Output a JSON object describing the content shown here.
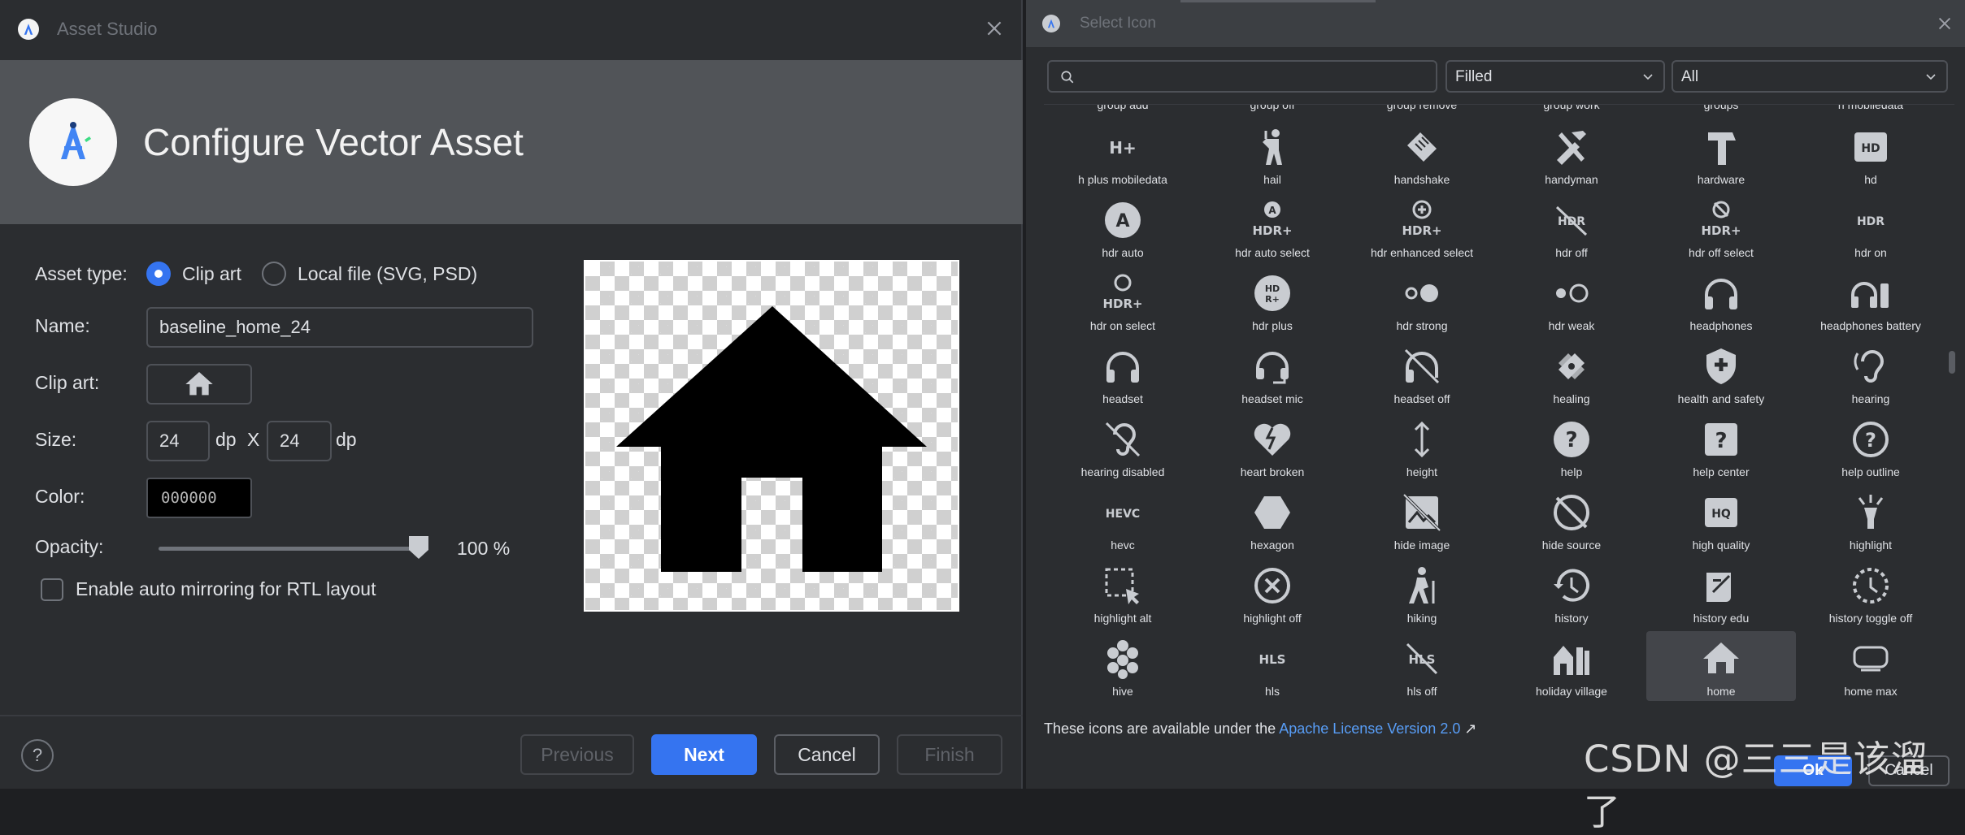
{
  "asset_studio": {
    "title": "Asset Studio",
    "header_title": "Configure Vector Asset",
    "asset_type_label": "Asset type:",
    "radio_clipart": "Clip art",
    "radio_localfile": "Local file (SVG, PSD)",
    "name_label": "Name:",
    "name_value": "baseline_home_24",
    "clipart_label": "Clip art:",
    "size_label": "Size:",
    "size_w": "24",
    "size_h": "24",
    "unit_dp": "dp",
    "size_x": "X",
    "color_label": "Color:",
    "color_value": "000000",
    "opacity_label": "Opacity:",
    "opacity_value": "100 %",
    "opacity_level": 1.0,
    "rtl_label": "Enable auto mirroring for RTL layout",
    "help": "?",
    "buttons": {
      "previous": "Previous",
      "next": "Next",
      "cancel": "Cancel",
      "finish": "Finish"
    }
  },
  "select_icon": {
    "title": "Select Icon",
    "style_dropdown": "Filled",
    "category_dropdown": "All",
    "top_row_cut": [
      "group add",
      "group off",
      "group remove",
      "group work",
      "groups",
      "h mobiledata"
    ],
    "icons": [
      {
        "label": "h plus mobiledata",
        "icon": "h-plus-mobiledata-icon"
      },
      {
        "label": "hail",
        "icon": "hail-icon"
      },
      {
        "label": "handshake",
        "icon": "handshake-icon"
      },
      {
        "label": "handyman",
        "icon": "handyman-icon"
      },
      {
        "label": "hardware",
        "icon": "hardware-icon"
      },
      {
        "label": "hd",
        "icon": "hd-icon"
      },
      {
        "label": "hdr auto",
        "icon": "hdr-auto-icon"
      },
      {
        "label": "hdr auto select",
        "icon": "hdr-auto-select-icon"
      },
      {
        "label": "hdr enhanced select",
        "icon": "hdr-enhanced-select-icon"
      },
      {
        "label": "hdr off",
        "icon": "hdr-off-icon"
      },
      {
        "label": "hdr off select",
        "icon": "hdr-off-select-icon"
      },
      {
        "label": "hdr on",
        "icon": "hdr-on-icon"
      },
      {
        "label": "hdr on select",
        "icon": "hdr-on-select-icon"
      },
      {
        "label": "hdr plus",
        "icon": "hdr-plus-icon"
      },
      {
        "label": "hdr strong",
        "icon": "hdr-strong-icon"
      },
      {
        "label": "hdr weak",
        "icon": "hdr-weak-icon"
      },
      {
        "label": "headphones",
        "icon": "headphones-icon"
      },
      {
        "label": "headphones battery",
        "icon": "headphones-battery-icon"
      },
      {
        "label": "headset",
        "icon": "headset-icon"
      },
      {
        "label": "headset mic",
        "icon": "headset-mic-icon"
      },
      {
        "label": "headset off",
        "icon": "headset-off-icon"
      },
      {
        "label": "healing",
        "icon": "healing-icon"
      },
      {
        "label": "health and safety",
        "icon": "health-and-safety-icon"
      },
      {
        "label": "hearing",
        "icon": "hearing-icon"
      },
      {
        "label": "hearing disabled",
        "icon": "hearing-disabled-icon"
      },
      {
        "label": "heart broken",
        "icon": "heart-broken-icon"
      },
      {
        "label": "height",
        "icon": "height-icon"
      },
      {
        "label": "help",
        "icon": "help-icon"
      },
      {
        "label": "help center",
        "icon": "help-center-icon"
      },
      {
        "label": "help outline",
        "icon": "help-outline-icon"
      },
      {
        "label": "hevc",
        "icon": "hevc-icon"
      },
      {
        "label": "hexagon",
        "icon": "hexagon-icon"
      },
      {
        "label": "hide image",
        "icon": "hide-image-icon"
      },
      {
        "label": "hide source",
        "icon": "hide-source-icon"
      },
      {
        "label": "high quality",
        "icon": "high-quality-icon"
      },
      {
        "label": "highlight",
        "icon": "highlight-icon"
      },
      {
        "label": "highlight alt",
        "icon": "highlight-alt-icon"
      },
      {
        "label": "highlight off",
        "icon": "highlight-off-icon"
      },
      {
        "label": "hiking",
        "icon": "hiking-icon"
      },
      {
        "label": "history",
        "icon": "history-icon"
      },
      {
        "label": "history edu",
        "icon": "history-edu-icon"
      },
      {
        "label": "history toggle off",
        "icon": "history-toggle-off-icon"
      },
      {
        "label": "hive",
        "icon": "hive-icon"
      },
      {
        "label": "hls",
        "icon": "hls-icon"
      },
      {
        "label": "hls off",
        "icon": "hls-off-icon"
      },
      {
        "label": "holiday village",
        "icon": "holiday-village-icon"
      },
      {
        "label": "home",
        "icon": "home-icon",
        "selected": true
      },
      {
        "label": "home max",
        "icon": "home-max-icon"
      }
    ],
    "license_prefix": "These icons are available under the ",
    "license_link": "Apache License Version 2.0",
    "license_arrow": "↗",
    "ok": "Ok",
    "cancel": "Cancel"
  },
  "watermark": "CSDN @三三是该溜了",
  "colors": {
    "accent": "#3574f0",
    "bg": "#2b2d30",
    "header": "#515458",
    "link": "#589df6"
  }
}
